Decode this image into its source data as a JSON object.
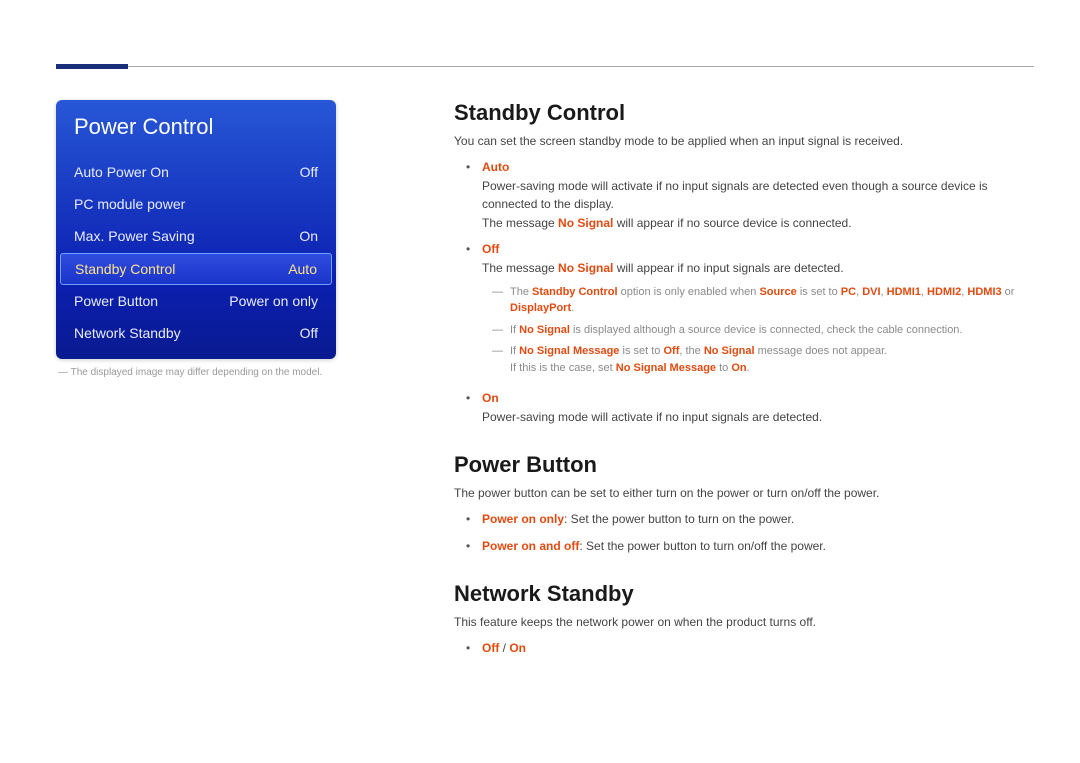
{
  "menu": {
    "title": "Power Control",
    "items": [
      {
        "label": "Auto Power On",
        "value": "Off",
        "selected": false
      },
      {
        "label": "PC module power",
        "value": "",
        "selected": false
      },
      {
        "label": "Max. Power Saving",
        "value": "On",
        "selected": false
      },
      {
        "label": "Standby Control",
        "value": "Auto",
        "selected": true
      },
      {
        "label": "Power Button",
        "value": "Power on only",
        "selected": false
      },
      {
        "label": "Network Standby",
        "value": "Off",
        "selected": false
      }
    ]
  },
  "panel_note_prefix": "―",
  "panel_note": " The displayed image may differ depending on the model.",
  "section_standby": {
    "heading": "Standby Control",
    "intro": "You can set the screen standby mode to be applied when an input signal is received.",
    "opt_auto": {
      "title": "Auto",
      "line1_a": "Power-saving mode will activate if no input signals are detected even though a source device is connected to the display.",
      "line2_a": "The message ",
      "line2_b": "No Signal",
      "line2_c": " will appear if no source device is connected."
    },
    "opt_off": {
      "title": "Off",
      "line1_a": "The message ",
      "line1_b": "No Signal",
      "line1_c": " will appear if no input signals are detected.",
      "note1_a": "The ",
      "note1_b": "Standby Control",
      "note1_c": " option is only enabled when ",
      "note1_d": "Source",
      "note1_e": " is set to ",
      "note1_f": "PC",
      "note1_g": ", ",
      "note1_h": "DVI",
      "note1_i": ", ",
      "note1_j": "HDMI1",
      "note1_k": ", ",
      "note1_l": "HDMI2",
      "note1_m": ", ",
      "note1_n": "HDMI3",
      "note1_o": " or ",
      "note1_p": "DisplayPort",
      "note1_q": ".",
      "note2_a": "If ",
      "note2_b": "No Signal",
      "note2_c": " is displayed although a source device is connected, check the cable connection.",
      "note3_a": "If ",
      "note3_b": "No Signal Message",
      "note3_c": " is set to ",
      "note3_d": "Off",
      "note3_e": ", the ",
      "note3_f": "No Signal",
      "note3_g": " message does not appear.",
      "note3_h": "If this is the case, set ",
      "note3_i": "No Signal Message",
      "note3_j": " to ",
      "note3_k": "On",
      "note3_l": "."
    },
    "opt_on": {
      "title": "On",
      "line1": "Power-saving mode will activate if no input signals are detected."
    }
  },
  "section_power_button": {
    "heading": "Power Button",
    "intro": "The power button can be set to either turn on the power or turn on/off the power.",
    "opt1_a": "Power on only",
    "opt1_b": ": Set the power button to turn on the power.",
    "opt2_a": "Power on and off",
    "opt2_b": ": Set the power button to turn on/off the power."
  },
  "section_network_standby": {
    "heading": "Network Standby",
    "intro": "This feature keeps the network power on when the product turns off.",
    "opt_off": "Off",
    "sep": " / ",
    "opt_on": "On"
  }
}
